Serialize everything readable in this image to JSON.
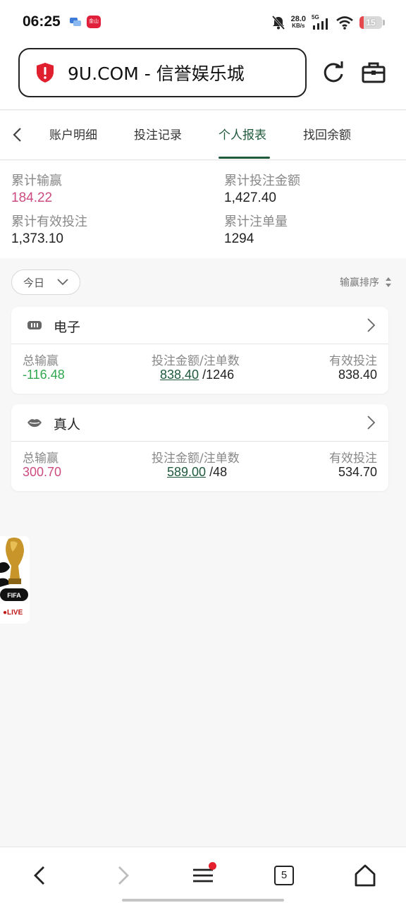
{
  "status_bar": {
    "time": "06:25",
    "net_speed_value": "28.0",
    "net_speed_unit": "KB/s",
    "signal_label": "5G",
    "battery": "15",
    "app_icon_text": "金山云"
  },
  "browser": {
    "url_title": "9U.COM - 信誉娱乐城"
  },
  "tabs": [
    {
      "label": "账户明细"
    },
    {
      "label": "投注记录"
    },
    {
      "label": "个人报表",
      "active": true
    },
    {
      "label": "找回余额"
    }
  ],
  "summary": {
    "total_win_loss_label": "累计输赢",
    "total_win_loss_value": "184.22",
    "total_bet_amount_label": "累计投注金额",
    "total_bet_amount_value": "1,427.40",
    "total_valid_bet_label": "累计有效投注",
    "total_valid_bet_value": "1,373.10",
    "total_bet_count_label": "累计注单量",
    "total_bet_count_value": "1294"
  },
  "filter": {
    "date": "今日",
    "sort": "输赢排序"
  },
  "cards": [
    {
      "title": "电子",
      "win_loss_label": "总输赢",
      "win_loss_value": "-116.48",
      "bet_label": "投注金额/注单数",
      "bet_amount": "838.40",
      "bet_count": "/1246",
      "valid_label": "有效投注",
      "valid_value": "838.40"
    },
    {
      "title": "真人",
      "win_loss_label": "总输赢",
      "win_loss_value": "300.70",
      "bet_label": "投注金额/注单数",
      "bet_amount": "589.00",
      "bet_count": "/48",
      "valid_label": "有效投注",
      "valid_value": "534.70"
    }
  ],
  "widget": {
    "badge": "FIFA",
    "live_label": "●LIVE"
  },
  "bottom_nav": {
    "tab_count": "5"
  },
  "colors": {
    "accent_green": "#1f5a3d",
    "positive_pink": "#cc4b80",
    "negative_green": "#2fa84f",
    "alert_red": "#e5202e"
  }
}
